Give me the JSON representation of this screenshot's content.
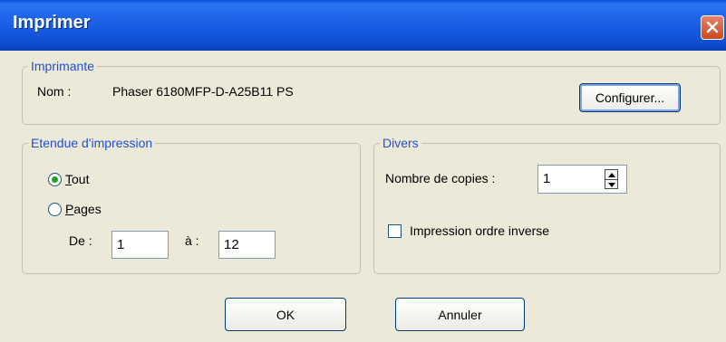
{
  "window": {
    "title": "Imprimer"
  },
  "printer": {
    "legend": "Imprimante",
    "name_label": "Nom :",
    "name_value": "Phaser 6180MFP-D-A25B11 PS",
    "configure_button": "Configurer..."
  },
  "range": {
    "legend": "Etendue d'impression",
    "all": {
      "mnemonic": "T",
      "rest": "out",
      "selected": true
    },
    "pages": {
      "mnemonic": "P",
      "rest": "ages",
      "selected": false
    },
    "from_label": "De :",
    "from_value": "1",
    "to_label": "à :",
    "to_value": "12"
  },
  "misc": {
    "legend": "Divers",
    "copies_label": "Nombre de copies :",
    "copies_value": "1",
    "reverse_label": "Impression ordre inverse",
    "reverse_checked": false
  },
  "buttons": {
    "ok": "OK",
    "cancel": "Annuler"
  }
}
